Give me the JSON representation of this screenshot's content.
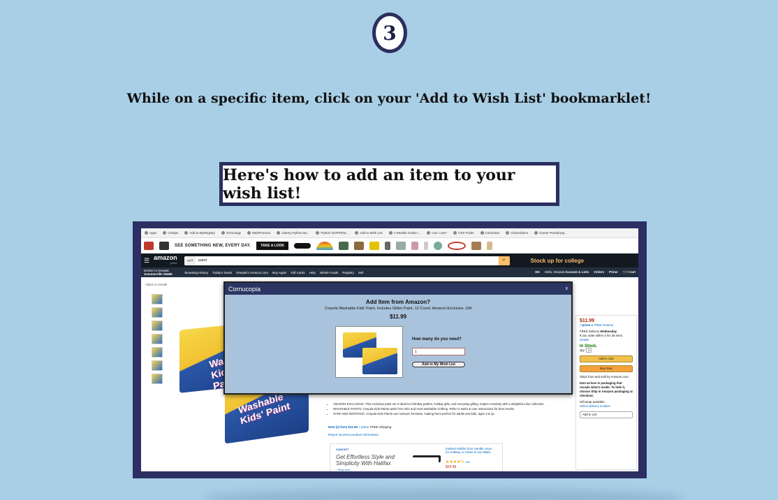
{
  "step": {
    "number": "3"
  },
  "instruction": "While on a specific item, click on your 'Add to Wish List' bookmarklet!",
  "howto_box": "Here's how to add an item to your wish list!",
  "browser": {
    "bookmarks": [
      "Apps",
      "CSSips",
      "Add to MyRegistry",
      "Schoology",
      "MathPractice",
      "Udemy Python Bo...",
      "Python OOPS/Pyt...",
      "Add to Wish List",
      "A Newbie Guide t...",
      "Can I use?",
      "CSS-Tricks",
      "Colormind",
      "ClassVideos",
      "Career Portal(App..."
    ],
    "promo": {
      "text": "SEE SOMETHING NEW, EVERY DAY.",
      "button": "TAKE A LOOK"
    },
    "amazon": {
      "logo": "amazon",
      "logo_sub": "prime",
      "search_category": "All",
      "search_query": "paint",
      "college_text": "Stock up for",
      "college_highlight": "college",
      "deliver_line1": "Deliver to Deepak",
      "deliver_line2": "Summerville 29485",
      "nav": [
        "Browsing History",
        "Today's Deals",
        "Deepak's Amazon.com",
        "Buy Again",
        "Gift Cards",
        "Help",
        "Whole Foods",
        "Registry",
        "Sell"
      ],
      "lang": "EN",
      "account": "Account & Lists",
      "account_hello": "Hello, Deepak",
      "orders": "Orders",
      "prime": "Prime",
      "cart": "Cart",
      "cart_count": "0"
    },
    "page": {
      "back": "‹ Back to results",
      "box_text": "Washable Kids' Paint",
      "bullets": [
        "AMAZON EXCLUSIVE: This exclusive paint set is ideal for birthday parties, holiday gifts, and everyday gifting. Inspire creativity with a delightful color collection.",
        "WASHABLE PAINTS: Crayola Kids Paints wash from skin and most washable clothing. Refer to wash & care instructions for best results.",
        "SAFE AND NONTOXIC: Crayola Kids Paints use nontoxic formulas, making them perfect for adults and kids, ages 3 & up."
      ],
      "new_from": "New (2) from $11.99",
      "new_from_tail": "FREE Shipping",
      "report": "Report incorrect product information.",
      "ad": {
        "brand": "KWIKSET",
        "slogan": "Get Effortless Style and Simplicity With Halifax",
        "shop": "› Shop now",
        "product": "Kwikset Halifax Door Handle Lever for Hallway or Closet in Iron Black",
        "stars": "★★★★½",
        "reviews": "182",
        "price": "$24.99"
      },
      "buybox": {
        "price": "$11.99",
        "prime": "✓prime",
        "free_returns": "& FREE Returns",
        "delivery": "FREE Delivery",
        "delivery_day": "Wednesday",
        "order_within": "If you order within 4 hrs 36 mins.",
        "details": "Details",
        "stock": "In Stock.",
        "qty_label": "Qty:",
        "qty": "1",
        "add_to_cart": "Add to Cart",
        "buy_now": "Buy Now",
        "ships": "Ships from and sold by Amazon.com.",
        "packaging": "Item arrives in packaging that reveals what's inside. To hide it, choose Ship in Amazon packaging at checkout.",
        "gift": "Gift-wrap available.",
        "location": "Select delivery location",
        "add_to_list": "Add to List"
      }
    },
    "modal": {
      "title": "Cornucopia",
      "close": "x",
      "heading": "Add Item from Amazon?",
      "item_name": "Crayola Washable Kids' Paint, Includes Glitter Paint, 12 Count, Amazon Exclusive, Gift",
      "price": "$11.99",
      "question": "How many do you need?",
      "qty_value": "1",
      "button": "Add to My Wish List"
    }
  }
}
